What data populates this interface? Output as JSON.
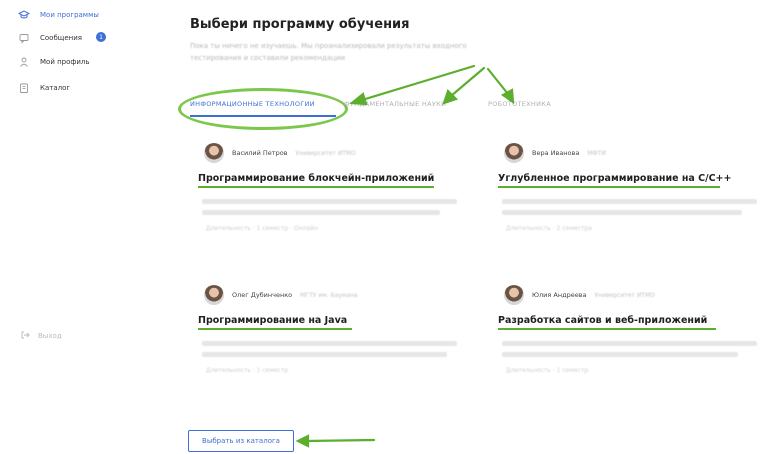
{
  "sidebar": {
    "items": [
      {
        "label": "Мои программы",
        "icon": "graduation-cap-icon",
        "active": true
      },
      {
        "label": "Сообщения",
        "icon": "chat-icon",
        "badge": "1"
      },
      {
        "label": "Мой профиль",
        "icon": "user-icon"
      },
      {
        "label": "Каталог",
        "icon": "catalog-icon"
      }
    ],
    "bottom_label": "Выход"
  },
  "main": {
    "title": "Выбери программу обучения",
    "subtitle": "Пока ты ничего не изучаешь. Мы проанализировали результаты входного тестирования и составили рекомендации",
    "tabs": [
      {
        "label": "Информационные технологии",
        "active": true
      },
      {
        "label": "Фундаментальные науки"
      },
      {
        "label": "Робототехника"
      }
    ],
    "cards": [
      {
        "author": "Василий Петров",
        "meta": "Университет ИТМО",
        "title": "Программирование блокчейн-приложений",
        "footer": "Длительность · 1 семестр · Онлайн"
      },
      {
        "author": "Вера Иванова",
        "meta": "МФТИ",
        "title": "Углубленное программирование на C/C++",
        "footer": "Длительность · 2 семестра"
      },
      {
        "author": "Олег Дубинченко",
        "meta": "МГТУ им. Баумана",
        "title": "Программирование на Java",
        "footer": "Длительность · 1 семестр"
      },
      {
        "author": "Юлия Андреева",
        "meta": "Университет ИТМО",
        "title": "Разработка сайтов и веб-приложений",
        "footer": "Длительность · 1 семестр"
      }
    ],
    "catalog_button": "Выбрать из каталога"
  },
  "colors": {
    "accent": "#3d6fd6",
    "annotation": "#5cae2e"
  }
}
